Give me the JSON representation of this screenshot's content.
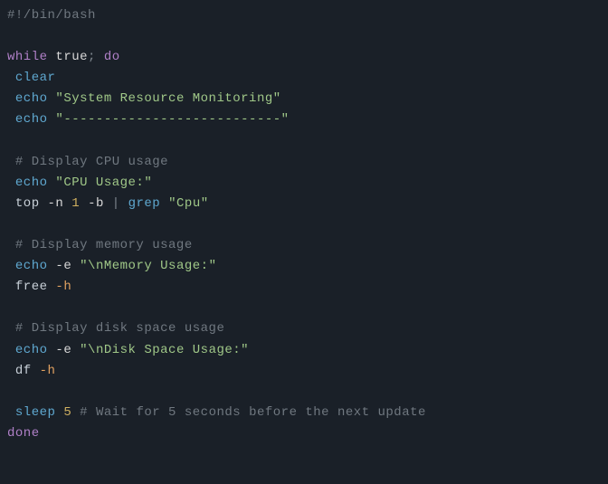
{
  "code": {
    "shebang": "#!/bin/bash",
    "while_kw": "while",
    "true_val": "true",
    "semicolon": ";",
    "do_kw": "do",
    "clear": "clear",
    "echo1": "echo",
    "str_title": "\"System Resource Monitoring\"",
    "echo2": "echo",
    "str_dashes": "\"---------------------------\"",
    "comment_cpu": "# Display CPU usage",
    "echo3": "echo",
    "str_cpu": "\"CPU Usage:\"",
    "top": "top",
    "top_n": "-n",
    "top_n_val": "1",
    "top_b": "-b",
    "pipe": "|",
    "grep": "grep",
    "str_cpu_grep": "\"Cpu\"",
    "comment_mem": "# Display memory usage",
    "echo4": "echo",
    "echo4_e": "-e",
    "str_mem": "\"\\nMemory Usage:\"",
    "free": "free",
    "free_h": "-h",
    "comment_disk": "# Display disk space usage",
    "echo5": "echo",
    "echo5_e": "-e",
    "str_disk": "\"\\nDisk Space Usage:\"",
    "df": "df",
    "df_h": "-h",
    "sleep": "sleep",
    "sleep_val": "5",
    "comment_sleep": "# Wait for 5 seconds before the next update",
    "done_kw": "done"
  }
}
